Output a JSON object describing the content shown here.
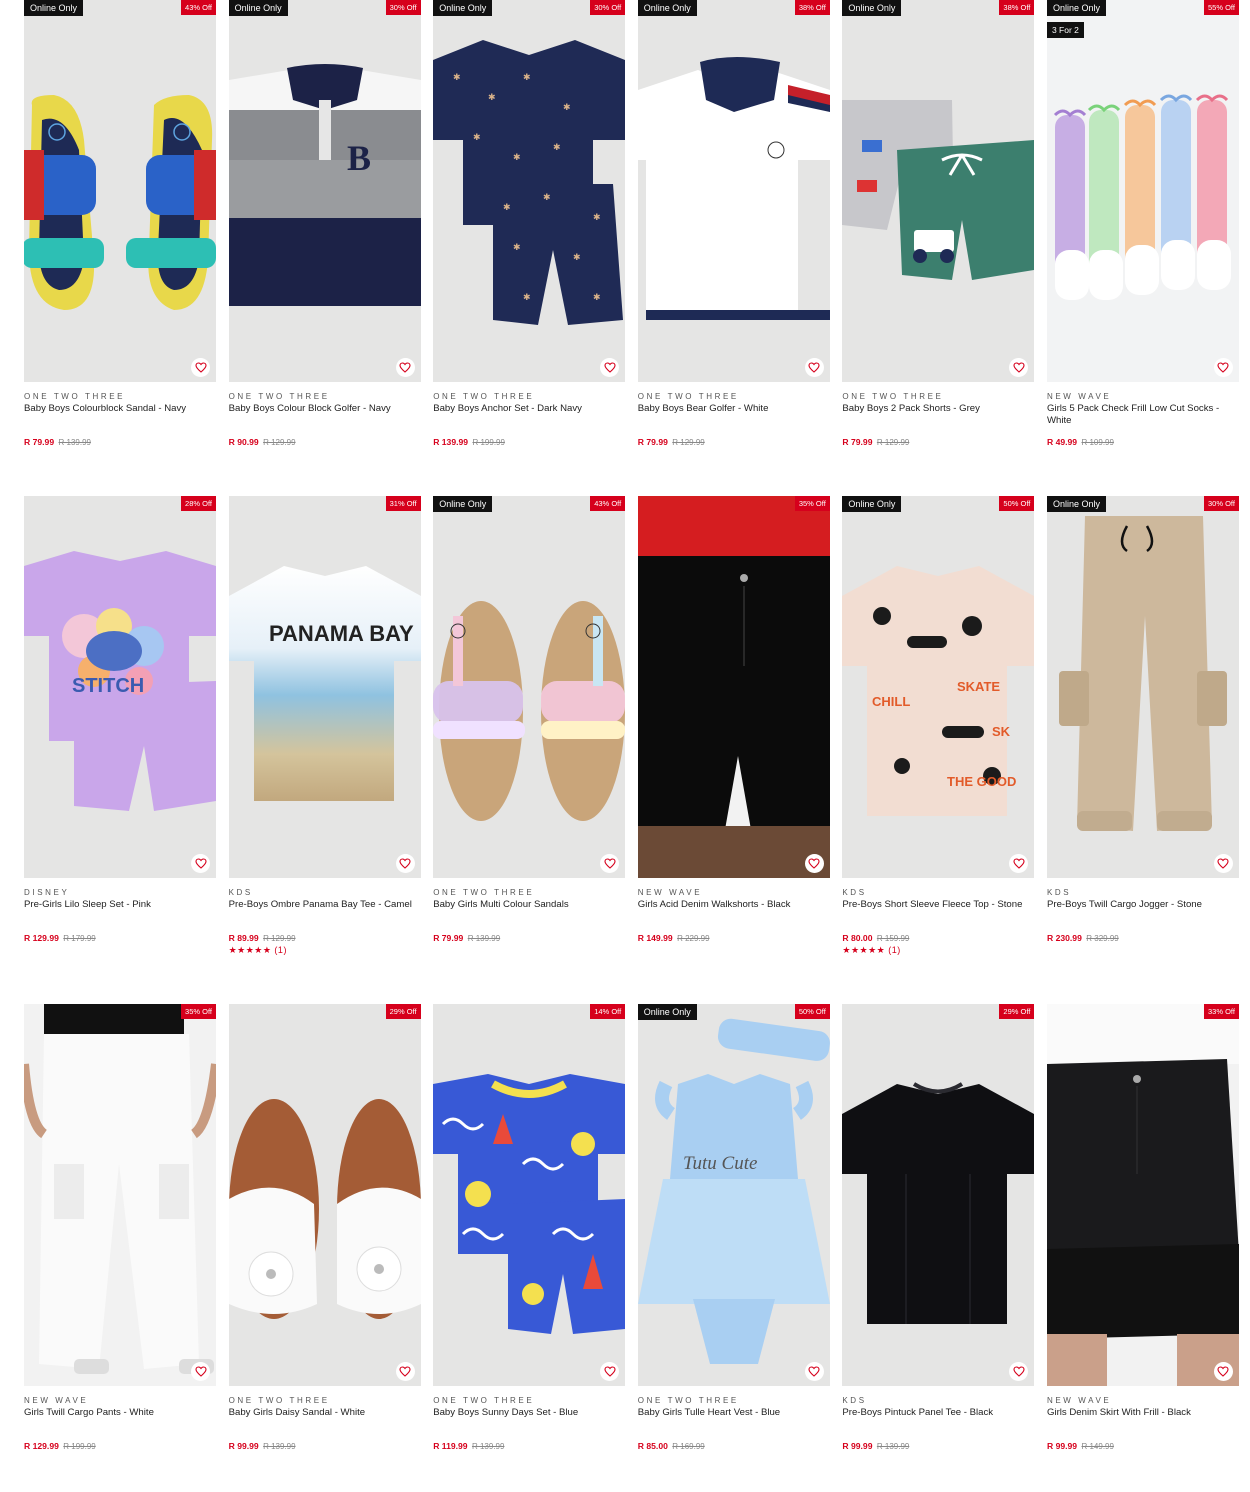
{
  "products": [
    {
      "online": "Online Only",
      "discount": "43% Off",
      "brand": "ONE TWO THREE",
      "title": "Baby Boys Colourblock Sandal - Navy",
      "price": "R 79.99",
      "was": "R 139.99",
      "art": "sandal-color"
    },
    {
      "online": "Online Only",
      "discount": "30% Off",
      "brand": "ONE TWO THREE",
      "title": "Baby Boys Colour Block Golfer - Navy",
      "price": "R 90.99",
      "was": "R 129.99",
      "art": "golfer-block"
    },
    {
      "online": "Online Only",
      "discount": "30% Off",
      "brand": "ONE TWO THREE",
      "title": "Baby Boys Anchor Set - Dark Navy",
      "price": "R 139.99",
      "was": "R 199.99",
      "art": "anchor-set"
    },
    {
      "online": "Online Only",
      "discount": "38% Off",
      "brand": "ONE TWO THREE",
      "title": "Baby Boys Bear Golfer - White",
      "price": "R 79.99",
      "was": "R 129.99",
      "art": "golfer-white"
    },
    {
      "online": "Online Only",
      "discount": "38% Off",
      "brand": "ONE TWO THREE",
      "title": "Baby Boys 2 Pack Shorts - Grey",
      "price": "R 79.99",
      "was": "R 129.99",
      "art": "shorts-2pack"
    },
    {
      "online": "Online Only",
      "promo": "3 For 2",
      "discount": "55% Off",
      "brand": "NEW WAVE",
      "title": "Girls 5 Pack Check Frill Low Cut Socks - White",
      "price": "R 49.99",
      "was": "R 109.99",
      "art": "socks"
    },
    {
      "discount": "28% Off",
      "brand": "DISNEY",
      "title": "Pre-Girls Lilo Sleep Set - Pink",
      "price": "R 129.99",
      "was": "R 179.99",
      "art": "lilo-set"
    },
    {
      "discount": "31% Off",
      "brand": "KDS",
      "title": "Pre-Boys Ombre Panama Bay Tee - Camel",
      "price": "R 89.99",
      "was": "R 129.99",
      "rating": "★★★★★ (1)",
      "art": "ombre-tee",
      "print": "PANAMA BAY"
    },
    {
      "online": "Online Only",
      "discount": "43% Off",
      "brand": "ONE TWO THREE",
      "title": "Baby Girls Multi Colour Sandals",
      "price": "R 79.99",
      "was": "R 139.99",
      "art": "sandal-rainbow"
    },
    {
      "discount": "35% Off",
      "brand": "NEW WAVE",
      "title": "Girls Acid Denim Walkshorts - Black",
      "price": "R 149.99",
      "was": "R 229.99",
      "art": "walkshorts"
    },
    {
      "online": "Online Only",
      "discount": "50% Off",
      "brand": "KDS",
      "title": "Pre-Boys Short Sleeve Fleece Top - Stone",
      "price": "R 80.00",
      "was": "R 159.99",
      "rating": "★★★★★ (1)",
      "art": "fleece-top"
    },
    {
      "online": "Online Only",
      "discount": "30% Off",
      "brand": "KDS",
      "title": "Pre-Boys Twill Cargo Jogger - Stone",
      "price": "R 230.99",
      "was": "R 329.99",
      "art": "cargo-jogger"
    },
    {
      "discount": "35% Off",
      "brand": "NEW WAVE",
      "title": "Girls Twill Cargo Pants - White",
      "price": "R 129.99",
      "was": "R 199.99",
      "art": "cargo-white"
    },
    {
      "discount": "29% Off",
      "brand": "ONE TWO THREE",
      "title": "Baby Girls Daisy Sandal - White",
      "price": "R 99.99",
      "was": "R 139.99",
      "art": "daisy-sandal"
    },
    {
      "discount": "14% Off",
      "brand": "ONE TWO THREE",
      "title": "Baby Boys Sunny Days Set - Blue",
      "price": "R 119.99",
      "was": "R 139.99",
      "art": "sunny-set"
    },
    {
      "online": "Online Only",
      "discount": "50% Off",
      "brand": "ONE TWO THREE",
      "title": "Baby Girls Tulle Heart Vest - Blue",
      "price": "R 85.00",
      "was": "R 169.99",
      "art": "tulle-vest",
      "print": "Tutu Cute"
    },
    {
      "discount": "29% Off",
      "brand": "KDS",
      "title": "Pre-Boys Pintuck Panel Tee - Black",
      "price": "R 99.99",
      "was": "R 139.99",
      "art": "black-tee"
    },
    {
      "discount": "33% Off",
      "brand": "NEW WAVE",
      "title": "Girls Denim Skirt With Frill - Black",
      "price": "R 99.99",
      "was": "R 149.99",
      "art": "denim-skirt"
    }
  ],
  "colors": {
    "discount": "#d6001c",
    "online_tag": "#111111",
    "image_bg": "#e5e5e4"
  }
}
